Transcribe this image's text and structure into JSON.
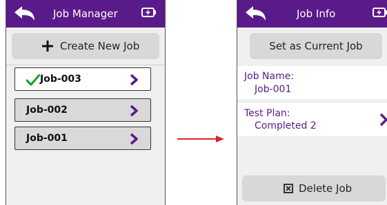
{
  "left": {
    "title": "Job Manager",
    "create_label": "Create New Job",
    "jobs": [
      {
        "name": "Job-003",
        "current": true
      },
      {
        "name": "Job-002",
        "current": false
      },
      {
        "name": "Job-001",
        "current": false
      }
    ]
  },
  "right": {
    "title": "Job Info",
    "set_current_label": "Set as Current Job",
    "job_name_label": "Job Name:",
    "job_name_value": "Job-001",
    "test_plan_label": "Test Plan:",
    "test_plan_value": "Completed 2",
    "delete_label": "Delete Job"
  },
  "colors": {
    "header": "#5b1a8a",
    "accent_text": "#5b1a8a",
    "check": "#22a022",
    "flow_arrow": "#d9262b"
  },
  "icons": [
    "back-arrow-icon",
    "battery-charging-icon",
    "plus-icon",
    "check-icon",
    "chevron-right-icon",
    "delete-box-icon"
  ]
}
